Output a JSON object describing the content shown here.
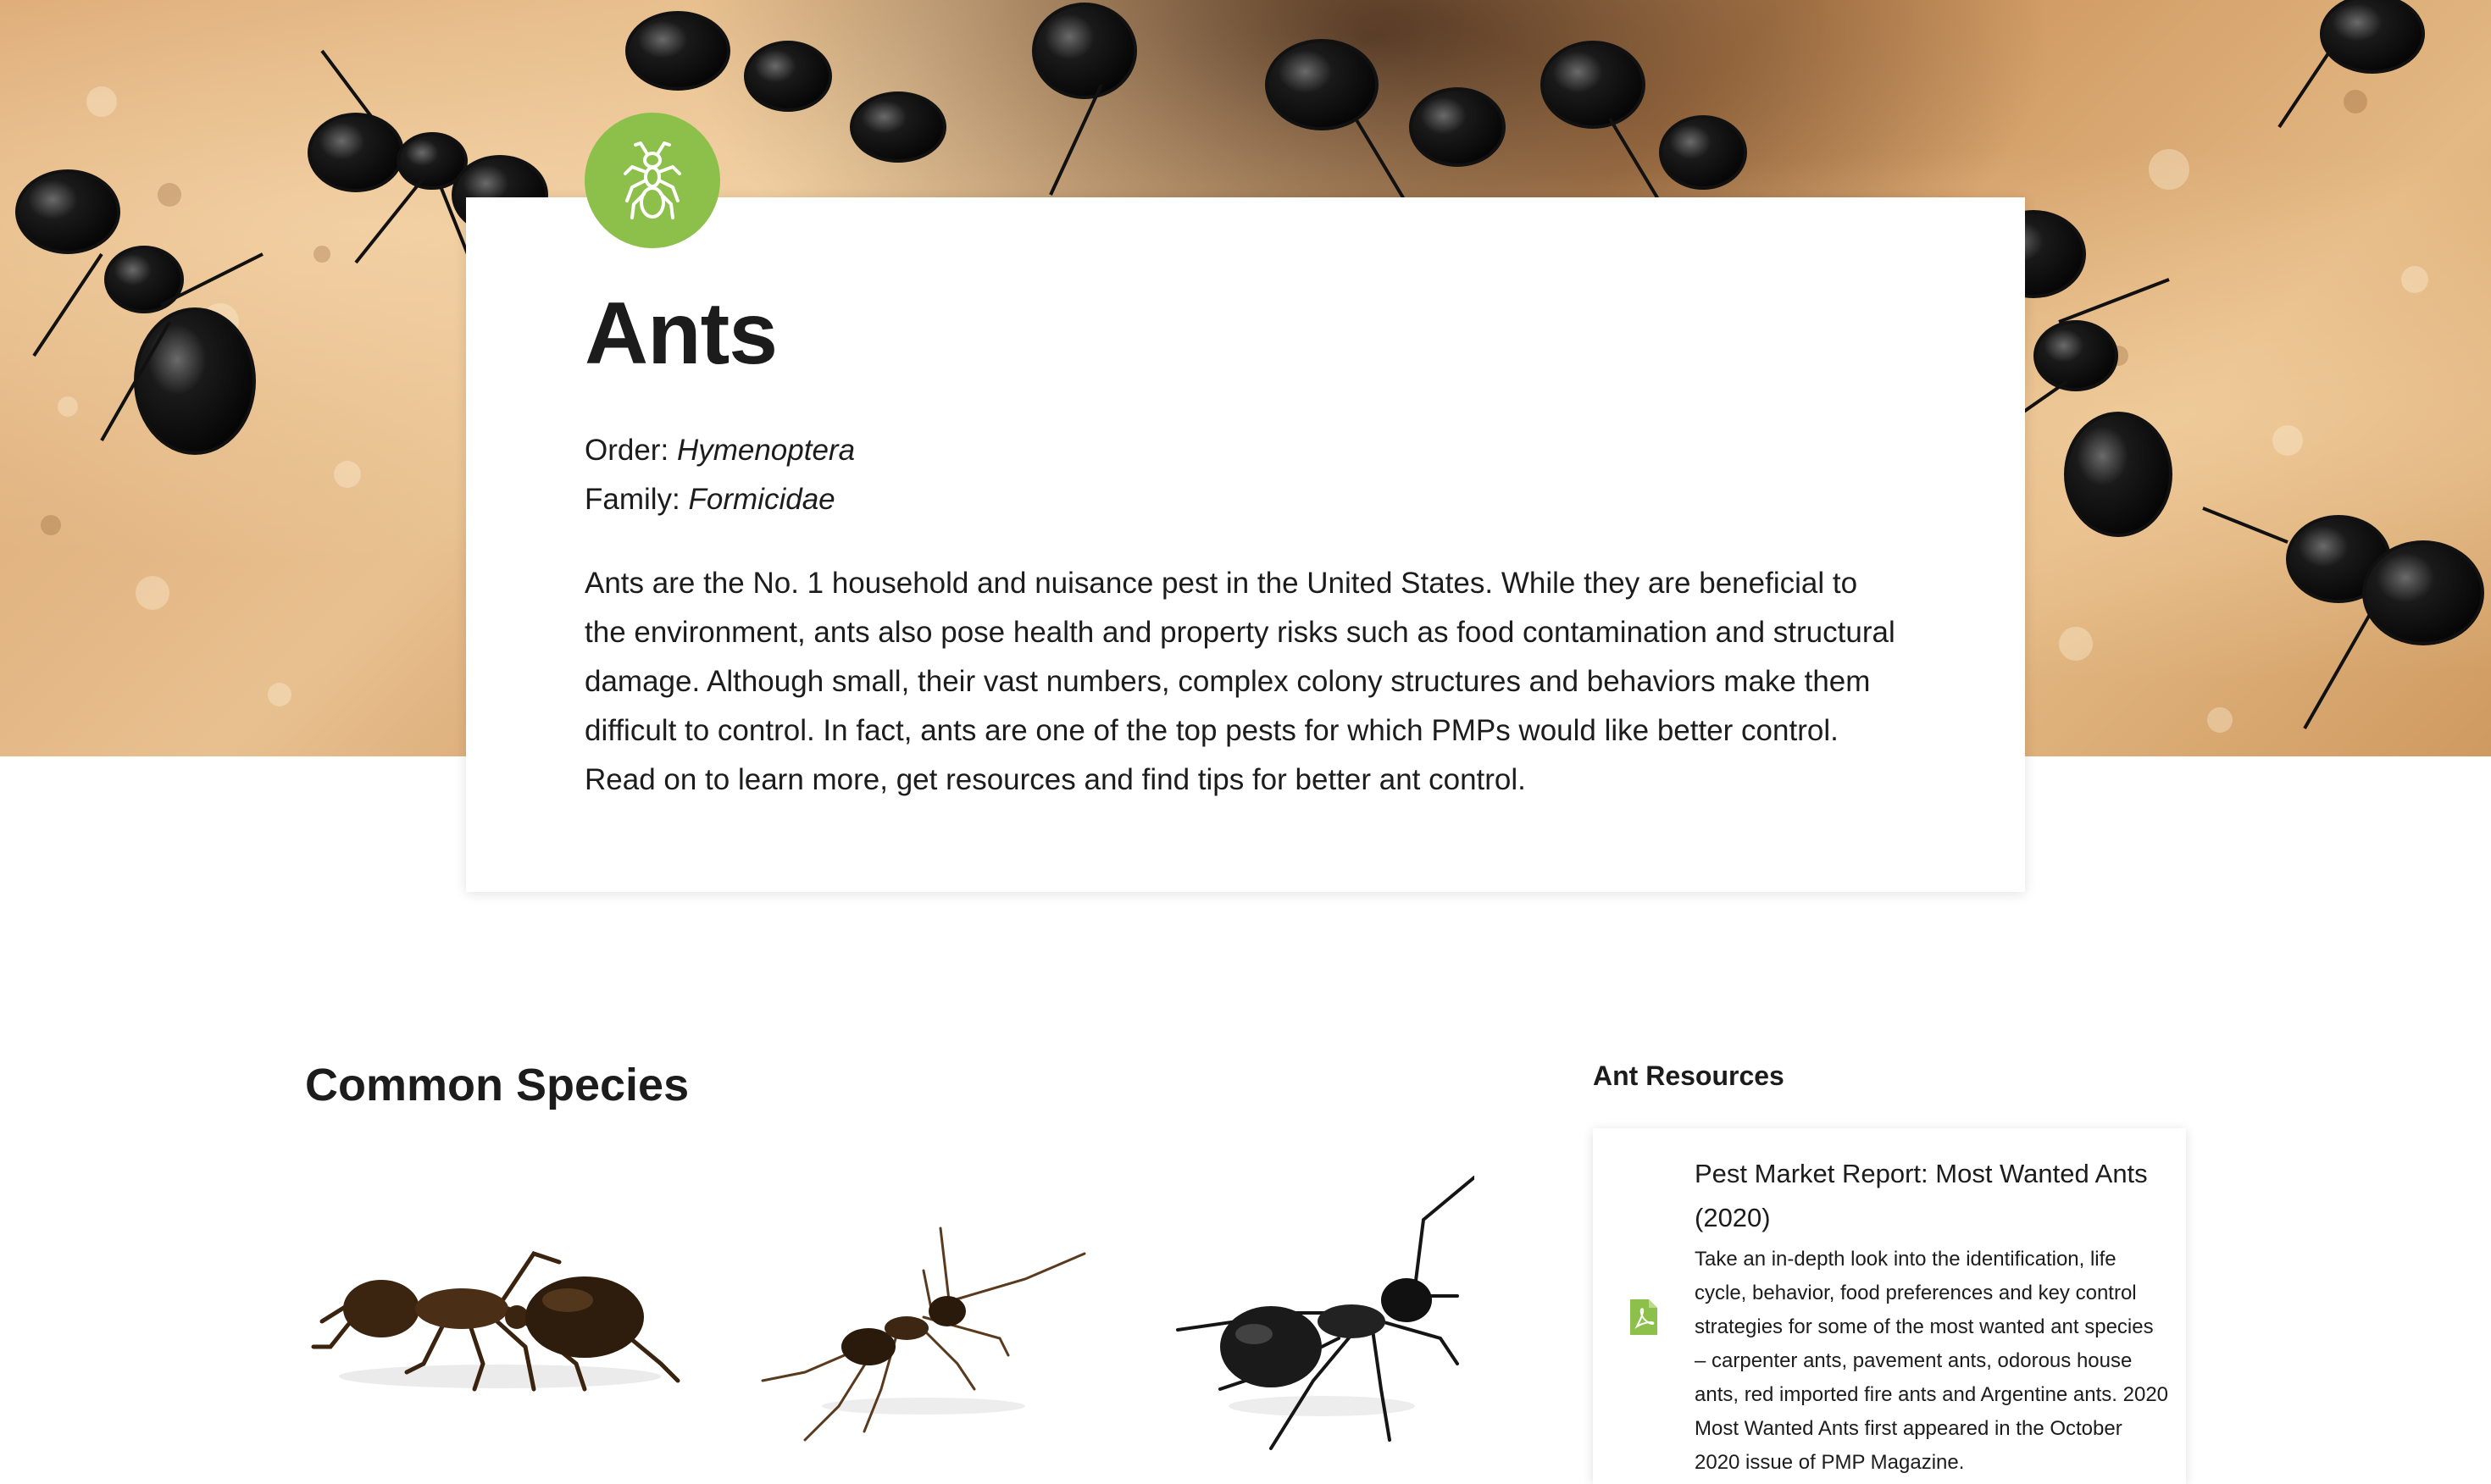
{
  "hero": {
    "image": "ant-colony-photo"
  },
  "page": {
    "icon": "ant-icon",
    "title": "Ants",
    "order_label": "Order:",
    "order_value": "Hymenoptera",
    "family_label": "Family:",
    "family_value": "Formicidae",
    "description": "Ants are the No. 1 household and nuisance pest in the United States. While they are beneficial to the environment, ants also pose health and property risks such as food contamination and structural damage. Although small, their vast numbers, complex colony structures and behaviors make them difficult to control. In fact, ants are one of the top pests for which PMPs would like better control. Read on to learn more, get resources and find tips for better ant control."
  },
  "species": {
    "heading": "Common Species"
  },
  "resources": {
    "heading": "Ant Resources",
    "items": [
      {
        "icon": "pdf-icon",
        "title": "Pest Market Report: Most Wanted Ants (2020)",
        "description": "Take an in-depth look into the identification, life cycle, behavior, food preferences and key control strategies for some of the most wanted ant species – carpenter ants, pavement ants, odorous house ants, red imported fire ants and Argentine ants. 2020 Most Wanted Ants first appeared in the October 2020 issue of PMP Magazine."
      }
    ]
  },
  "colors": {
    "accent": "#8cc04b",
    "text": "#1c1c1c"
  }
}
